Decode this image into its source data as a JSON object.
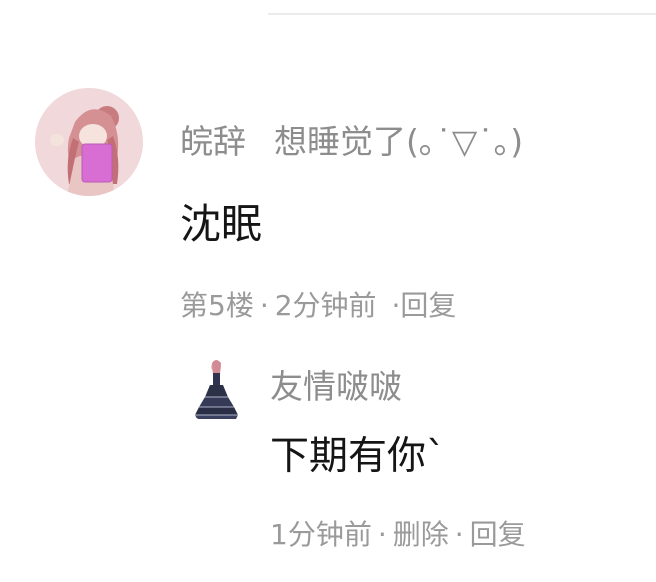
{
  "comment": {
    "author": "皖辞",
    "author_signature": "想睡觉了(｡˙▽˙｡)",
    "text": "沈眠",
    "floor": "第5楼",
    "time": "2分钟前",
    "reply_label": "回复",
    "reply": {
      "author": "友情啵啵",
      "text": "下期有你`",
      "time": "1分钟前",
      "delete_label": "删除",
      "reply_label": "回复"
    }
  },
  "icons": {
    "main_avatar": "user-avatar-anime-girl",
    "reply_avatar": "user-avatar-gown-figure"
  }
}
